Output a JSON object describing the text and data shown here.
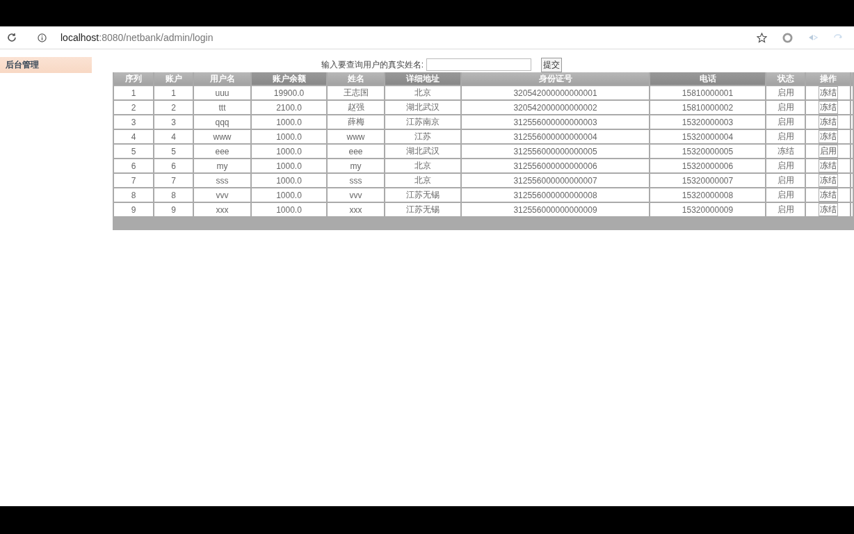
{
  "browser": {
    "url_host": "localhost",
    "url_rest": ":8080/netbank/admin/login"
  },
  "sidebar": {
    "items": [
      {
        "label": "后台管理",
        "selected": true
      }
    ]
  },
  "search": {
    "label": "输入要查询用户的真实姓名:",
    "submit": "提交"
  },
  "table": {
    "columns": [
      {
        "label": "序列",
        "highlighted": false
      },
      {
        "label": "账户",
        "highlighted": false
      },
      {
        "label": "用户名",
        "highlighted": false
      },
      {
        "label": "账户余额",
        "highlighted": true
      },
      {
        "label": "姓名",
        "highlighted": false
      },
      {
        "label": "详细地址",
        "highlighted": true
      },
      {
        "label": "身份证号",
        "highlighted": false
      },
      {
        "label": "电话",
        "highlighted": true
      },
      {
        "label": "状态",
        "highlighted": false
      },
      {
        "label": "操作",
        "highlighted": false
      }
    ],
    "rows": [
      {
        "cells": [
          "1",
          "1",
          "uuu",
          "19900.0",
          "王志国",
          "北京",
          "320542000000000001",
          "15810000001",
          "启用"
        ],
        "action": "冻结"
      },
      {
        "cells": [
          "2",
          "2",
          "ttt",
          "2100.0",
          "赵强",
          "湖北武汉",
          "320542000000000002",
          "15810000002",
          "启用"
        ],
        "action": "冻结"
      },
      {
        "cells": [
          "3",
          "3",
          "qqq",
          "1000.0",
          "薛梅",
          "江苏南京",
          "312556000000000003",
          "15320000003",
          "启用"
        ],
        "action": "冻结"
      },
      {
        "cells": [
          "4",
          "4",
          "www",
          "1000.0",
          "www",
          "江苏",
          "312556000000000004",
          "15320000004",
          "启用"
        ],
        "action": "冻结"
      },
      {
        "cells": [
          "5",
          "5",
          "eee",
          "1000.0",
          "eee",
          "湖北武汉",
          "312556000000000005",
          "15320000005",
          "冻结"
        ],
        "action": "启用"
      },
      {
        "cells": [
          "6",
          "6",
          "my",
          "1000.0",
          "my",
          "北京",
          "312556000000000006",
          "15320000006",
          "启用"
        ],
        "action": "冻结"
      },
      {
        "cells": [
          "7",
          "7",
          "sss",
          "1000.0",
          "sss",
          "北京",
          "312556000000000007",
          "15320000007",
          "启用"
        ],
        "action": "冻结"
      },
      {
        "cells": [
          "8",
          "8",
          "vvv",
          "1000.0",
          "vvv",
          "江苏无锡",
          "312556000000000008",
          "15320000008",
          "启用"
        ],
        "action": "冻结"
      },
      {
        "cells": [
          "9",
          "9",
          "xxx",
          "1000.0",
          "xxx",
          "江苏无锡",
          "312556000000000009",
          "15320000009",
          "启用"
        ],
        "action": "冻结"
      }
    ]
  }
}
